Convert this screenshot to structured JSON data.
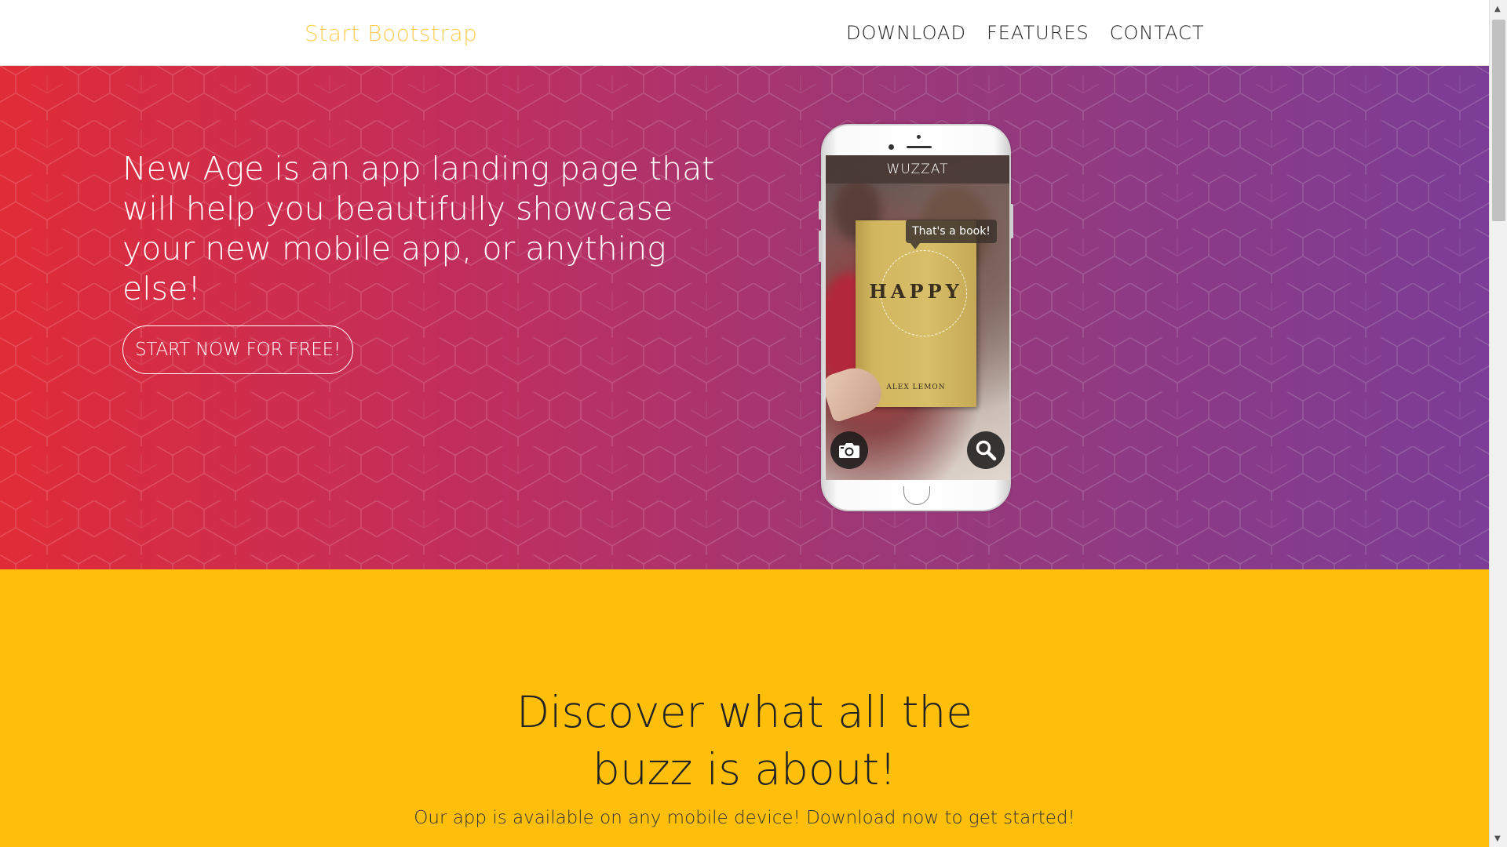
{
  "navbar": {
    "brand": "Start Bootstrap",
    "links": [
      "DOWNLOAD",
      "FEATURES",
      "CONTACT"
    ]
  },
  "hero": {
    "heading": "New Age is an app landing page that will help you beautifully showcase your new mobile app, or anything else!",
    "cta_label": "START NOW FOR FREE!",
    "phone": {
      "app_name": "WUZZAT",
      "tooltip": "That's a book!",
      "book_title": "HAPPY",
      "book_author": "ALEX LEMON",
      "left_button_icon": "camera-icon",
      "right_button_icon": "search-icon"
    }
  },
  "download": {
    "heading_line1": "Discover what all the",
    "heading_line2": "buzz is about!",
    "text": "Our app is available on any mobile device! Download now to get started!"
  },
  "colors": {
    "brand": "#fdcc52",
    "hero_gradient_start": "#e02c37",
    "hero_gradient_end": "#7b3d96",
    "download_bg": "#fdbf0a"
  }
}
